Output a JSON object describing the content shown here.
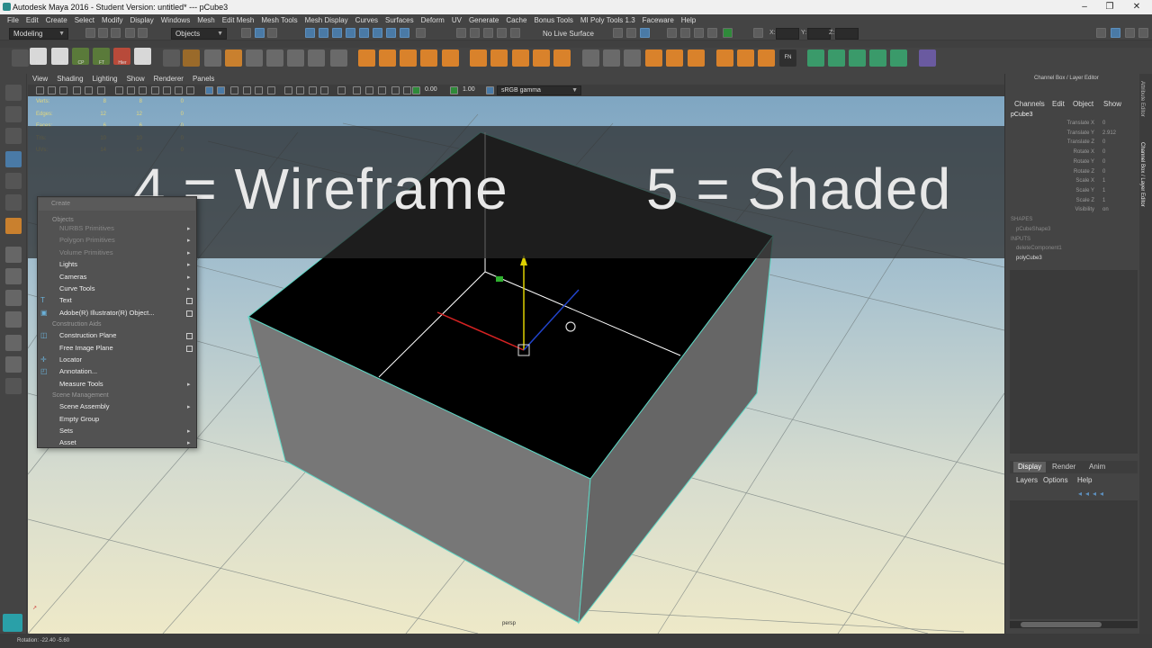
{
  "window": {
    "title": "Autodesk Maya 2016 - Student Version: untitled*   ---   pCube3",
    "minimize": "–",
    "maximize": "❐",
    "close": "✕"
  },
  "menubar": [
    "File",
    "Edit",
    "Create",
    "Select",
    "Modify",
    "Display",
    "Windows",
    "Mesh",
    "Edit Mesh",
    "Mesh Tools",
    "Mesh Display",
    "Curves",
    "Surfaces",
    "Deform",
    "UV",
    "Generate",
    "Cache",
    "Bonus Tools",
    "MI Poly Tools 1.3",
    "Faceware",
    "Help"
  ],
  "statusline": {
    "mode": "Modeling",
    "select_mode": "Objects",
    "live_surface": "No Live Surface",
    "x_label": "X:",
    "y_label": "Y:",
    "z_label": "Z:"
  },
  "shelf": {
    "labels": [
      "BC",
      "Hist",
      "CP",
      "FT",
      "Hier",
      "DS"
    ],
    "fn_label": "FN"
  },
  "panel": {
    "menu": [
      "View",
      "Shading",
      "Lighting",
      "Show",
      "Renderer",
      "Panels"
    ],
    "exposure": "0.00",
    "gamma": "1.00",
    "colorspace": "sRGB gamma"
  },
  "hud": {
    "rows": [
      {
        "label": "Verts:",
        "a": "8",
        "b": "8",
        "c": "0"
      },
      {
        "label": "Edges:",
        "a": "12",
        "b": "12",
        "c": "0"
      },
      {
        "label": "Faces:",
        "a": "6",
        "b": "6",
        "c": "0"
      },
      {
        "label": "Tris:",
        "a": "10",
        "b": "10",
        "c": "0"
      },
      {
        "label": "UVs:",
        "a": "14",
        "b": "14",
        "c": "0"
      }
    ]
  },
  "overlay": {
    "left": "4 = Wireframe",
    "right": "5 = Shaded"
  },
  "create_menu": {
    "header": "Create",
    "items": [
      {
        "kind": "section",
        "label": "Objects"
      },
      {
        "kind": "item",
        "label": "NURBS Primitives",
        "dim": true,
        "submenu": true
      },
      {
        "kind": "item",
        "label": "Polygon Primitives",
        "dim": true,
        "submenu": true
      },
      {
        "kind": "item",
        "label": "Volume Primitives",
        "dim": true,
        "submenu": true
      },
      {
        "kind": "item",
        "label": "Lights",
        "submenu": true
      },
      {
        "kind": "item",
        "label": "Cameras",
        "submenu": true
      },
      {
        "kind": "item",
        "label": "Curve Tools",
        "submenu": true
      },
      {
        "kind": "item",
        "label": "Text",
        "icon": "T",
        "option": true
      },
      {
        "kind": "item",
        "label": "Adobe(R) Illustrator(R) Object...",
        "icon": "▣",
        "option": true
      },
      {
        "kind": "section",
        "label": "Construction Aids"
      },
      {
        "kind": "item",
        "label": "Construction Plane",
        "icon": "◫",
        "option": true
      },
      {
        "kind": "item",
        "label": "Free Image Plane",
        "option": true
      },
      {
        "kind": "item",
        "label": "Locator",
        "icon": "✛"
      },
      {
        "kind": "item",
        "label": "Annotation...",
        "icon": "◰"
      },
      {
        "kind": "item",
        "label": "Measure Tools",
        "submenu": true
      },
      {
        "kind": "section",
        "label": "Scene Management"
      },
      {
        "kind": "item",
        "label": "Scene Assembly",
        "submenu": true
      },
      {
        "kind": "item",
        "label": "Empty Group"
      },
      {
        "kind": "item",
        "label": "Sets",
        "submenu": true
      },
      {
        "kind": "item",
        "label": "Asset",
        "submenu": true
      }
    ]
  },
  "viewport": {
    "camera_label": "persp"
  },
  "channel_box": {
    "title": "Channel Box / Layer Editor",
    "menu": [
      "Channels",
      "Edit",
      "Object",
      "Show"
    ],
    "object": "pCube3",
    "attributes": [
      {
        "name": "Translate X",
        "value": "0"
      },
      {
        "name": "Translate Y",
        "value": "2.912"
      },
      {
        "name": "Translate Z",
        "value": "0"
      },
      {
        "name": "Rotate X",
        "value": "0"
      },
      {
        "name": "Rotate Y",
        "value": "0"
      },
      {
        "name": "Rotate Z",
        "value": "0"
      },
      {
        "name": "Scale X",
        "value": "1"
      },
      {
        "name": "Scale Y",
        "value": "1"
      },
      {
        "name": "Scale Z",
        "value": "1"
      },
      {
        "name": "Visibility",
        "value": "on"
      }
    ],
    "shapes_header": "SHAPES",
    "shape": "pCubeShape3",
    "inputs_header": "INPUTS",
    "inputs": [
      "deleteComponent1",
      "polyCube3"
    ]
  },
  "layer_editor": {
    "tabs": [
      "Display",
      "Render",
      "Anim"
    ],
    "active_tab": "Display",
    "menu": [
      "Layers",
      "Options",
      "Help"
    ]
  },
  "side_tabs": [
    "Attribute Editor",
    "Channel Box / Layer Editor"
  ],
  "helpline": {
    "text": "Rotation:   -22.40      -5.60"
  },
  "colors": {
    "accent": "#5d8fbd",
    "hud": "#e2d77e",
    "selection_edge": "#5ed6c4"
  }
}
